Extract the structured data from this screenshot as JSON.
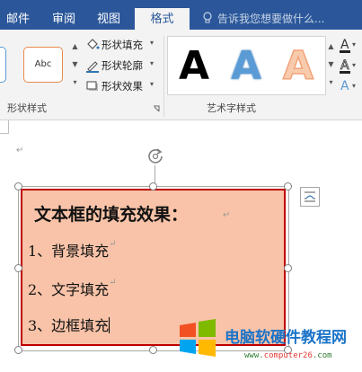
{
  "tabs": [
    {
      "label": "邮件",
      "active": false
    },
    {
      "label": "审阅",
      "active": false
    },
    {
      "label": "视图",
      "active": false
    },
    {
      "label": "格式",
      "active": true
    }
  ],
  "tell_me": {
    "icon": "lightbulb-icon",
    "text": "告诉我您想要做什么..."
  },
  "ribbon": {
    "shape_styles": {
      "group_label": "形状样式",
      "preview_label": "Abc",
      "commands": [
        {
          "label": "形状填充",
          "icon": "paint-bucket-icon"
        },
        {
          "label": "形状轮廓",
          "icon": "pencil-outline-icon"
        },
        {
          "label": "形状效果",
          "icon": "shape-effects-icon"
        }
      ]
    },
    "wordart_styles": {
      "group_label": "艺术字样式",
      "previews": [
        {
          "letter": "A",
          "style": "black",
          "color": "#000000"
        },
        {
          "letter": "A",
          "style": "blue-gradient",
          "color": "#5b9bd5"
        },
        {
          "letter": "A",
          "style": "orange-outline",
          "color": "#f4b183"
        }
      ],
      "right_buttons": [
        "text-fill-icon",
        "text-outline-icon",
        "text-effects-icon"
      ]
    }
  },
  "document": {
    "paragraph_mark": "↵",
    "textbox": {
      "title": "文本框的填充效果：",
      "lines": [
        "1、背景填充",
        "2、文字填充",
        "3、边框填充"
      ],
      "fill_color": "#f8c3a8",
      "border_color": "#c00000"
    }
  },
  "watermark": {
    "name": "电脑软硬件教程网",
    "url_prefix": "www.",
    "url_mid": "computer26",
    "url_suffix": ".com"
  }
}
